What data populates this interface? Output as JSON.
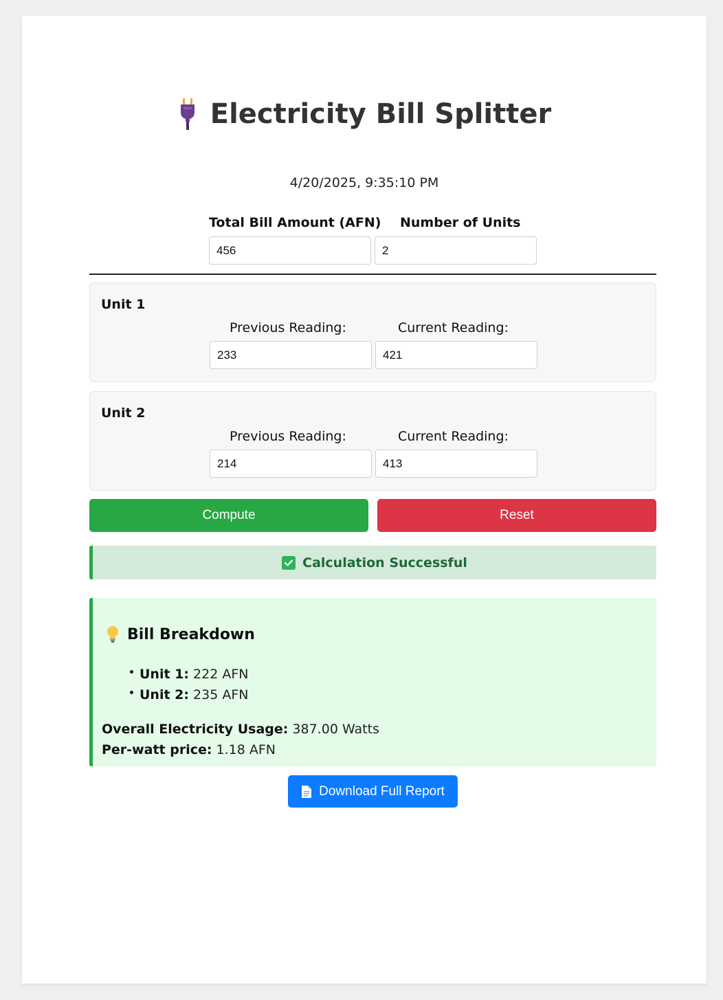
{
  "app": {
    "title": "Electricity Bill Splitter",
    "timestamp": "4/20/2025, 9:35:10 PM"
  },
  "bill": {
    "total_label": "Total Bill Amount (AFN)",
    "total_value": "456",
    "units_label": "Number of Units",
    "units_value": "2"
  },
  "units": [
    {
      "title": "Unit 1",
      "previous_label": "Previous Reading:",
      "previous_value": "233",
      "current_label": "Current Reading:",
      "current_value": "421"
    },
    {
      "title": "Unit 2",
      "previous_label": "Previous Reading:",
      "previous_value": "214",
      "current_label": "Current Reading:",
      "current_value": "413"
    }
  ],
  "actions": {
    "compute_label": "Compute",
    "reset_label": "Reset",
    "download_label": "Download Full Report"
  },
  "status": {
    "message": "Calculation Successful"
  },
  "breakdown": {
    "title": "Bill Breakdown",
    "items": [
      {
        "label": "Unit 1:",
        "value": "222 AFN"
      },
      {
        "label": "Unit 2:",
        "value": "235 AFN"
      }
    ],
    "usage_label": "Overall Electricity Usage:",
    "usage_value": "387.00 Watts",
    "price_label": "Per-watt price:",
    "price_value": "1.18 AFN"
  },
  "colors": {
    "compute": "#28a745",
    "reset": "#dc3545",
    "download": "#0d7bff",
    "success_bg": "#d4eadb",
    "breakdown_bg": "#e4fbe8"
  },
  "icons": {
    "title_icon": "electric-plug-icon",
    "status_icon": "check-box-icon",
    "breakdown_icon": "light-bulb-icon",
    "download_icon": "document-icon"
  }
}
